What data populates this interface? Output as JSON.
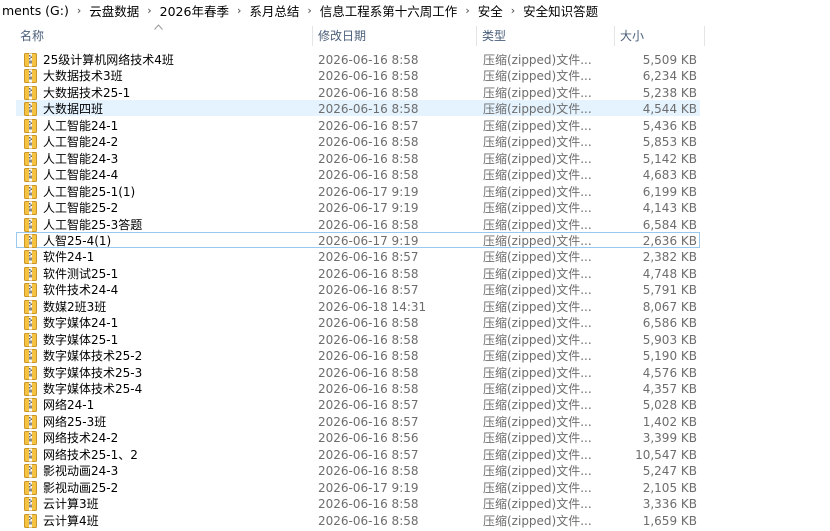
{
  "breadcrumb": [
    "ments (G:)",
    "云盘数据",
    "2026年春季",
    "系月总结",
    "信息工程系第十六周工作",
    "安全",
    "安全知识答题"
  ],
  "columns": {
    "name": "名称",
    "date": "修改日期",
    "type": "类型",
    "size": "大小"
  },
  "files": [
    {
      "name": "25级计算机网络技术4班",
      "date": "2026-06-16 8:58",
      "type": "压缩(zipped)文件...",
      "size": "5,509 KB"
    },
    {
      "name": "大数据技术3班",
      "date": "2026-06-16 8:58",
      "type": "压缩(zipped)文件...",
      "size": "6,234 KB"
    },
    {
      "name": "大数据技术25-1",
      "date": "2026-06-16 8:58",
      "type": "压缩(zipped)文件...",
      "size": "5,238 KB"
    },
    {
      "name": "大数据四班",
      "date": "2026-06-16 8:58",
      "type": "压缩(zipped)文件...",
      "size": "4,544 KB"
    },
    {
      "name": "人工智能24-1",
      "date": "2026-06-16 8:57",
      "type": "压缩(zipped)文件...",
      "size": "5,436 KB"
    },
    {
      "name": "人工智能24-2",
      "date": "2026-06-16 8:58",
      "type": "压缩(zipped)文件...",
      "size": "5,853 KB"
    },
    {
      "name": "人工智能24-3",
      "date": "2026-06-16 8:58",
      "type": "压缩(zipped)文件...",
      "size": "5,142 KB"
    },
    {
      "name": "人工智能24-4",
      "date": "2026-06-16 8:58",
      "type": "压缩(zipped)文件...",
      "size": "4,683 KB"
    },
    {
      "name": "人工智能25-1(1)",
      "date": "2026-06-17 9:19",
      "type": "压缩(zipped)文件...",
      "size": "6,199 KB"
    },
    {
      "name": "人工智能25-2",
      "date": "2026-06-17 9:19",
      "type": "压缩(zipped)文件...",
      "size": "4,143 KB"
    },
    {
      "name": "人工智能25-3答题",
      "date": "2026-06-16 8:58",
      "type": "压缩(zipped)文件...",
      "size": "6,584 KB"
    },
    {
      "name": "人智25-4(1)",
      "date": "2026-06-17 9:19",
      "type": "压缩(zipped)文件...",
      "size": "2,636 KB"
    },
    {
      "name": "软件24-1",
      "date": "2026-06-16 8:57",
      "type": "压缩(zipped)文件...",
      "size": "2,382 KB"
    },
    {
      "name": "软件测试25-1",
      "date": "2026-06-16 8:58",
      "type": "压缩(zipped)文件...",
      "size": "4,748 KB"
    },
    {
      "name": "软件技术24-4",
      "date": "2026-06-16 8:57",
      "type": "压缩(zipped)文件...",
      "size": "5,791 KB"
    },
    {
      "name": "数媒2班3班",
      "date": "2026-06-18 14:31",
      "type": "压缩(zipped)文件...",
      "size": "8,067 KB"
    },
    {
      "name": "数字媒体24-1",
      "date": "2026-06-16 8:58",
      "type": "压缩(zipped)文件...",
      "size": "6,586 KB"
    },
    {
      "name": "数字媒体25-1",
      "date": "2026-06-16 8:58",
      "type": "压缩(zipped)文件...",
      "size": "5,903 KB"
    },
    {
      "name": "数字媒体技术25-2",
      "date": "2026-06-16 8:58",
      "type": "压缩(zipped)文件...",
      "size": "5,190 KB"
    },
    {
      "name": "数字媒体技术25-3",
      "date": "2026-06-16 8:58",
      "type": "压缩(zipped)文件...",
      "size": "4,576 KB"
    },
    {
      "name": "数字媒体技术25-4",
      "date": "2026-06-16 8:58",
      "type": "压缩(zipped)文件...",
      "size": "4,357 KB"
    },
    {
      "name": "网络24-1",
      "date": "2026-06-16 8:57",
      "type": "压缩(zipped)文件...",
      "size": "5,028 KB"
    },
    {
      "name": "网络25-3班",
      "date": "2026-06-16 8:57",
      "type": "压缩(zipped)文件...",
      "size": "1,402 KB"
    },
    {
      "name": "网络技术24-2",
      "date": "2026-06-16 8:56",
      "type": "压缩(zipped)文件...",
      "size": "3,399 KB"
    },
    {
      "name": "网络技术25-1、2",
      "date": "2026-06-16 8:57",
      "type": "压缩(zipped)文件...",
      "size": "10,547 KB"
    },
    {
      "name": "影视动画24-3",
      "date": "2026-06-16 8:58",
      "type": "压缩(zipped)文件...",
      "size": "5,247 KB"
    },
    {
      "name": "影视动画25-2",
      "date": "2026-06-17 9:19",
      "type": "压缩(zipped)文件...",
      "size": "2,105 KB"
    },
    {
      "name": "云计算3班",
      "date": "2026-06-16 8:58",
      "type": "压缩(zipped)文件...",
      "size": "3,336 KB"
    },
    {
      "name": "云计算4班",
      "date": "2026-06-16 8:58",
      "type": "压缩(zipped)文件...",
      "size": "1,659 KB"
    }
  ],
  "selected_row": "大数据四班",
  "focused_row": "人智25-4(1)",
  "icons": {
    "file": "zip-folder-icon",
    "sort": "sort-ascending-icon",
    "separator": "chevron-right-icon"
  },
  "colors": {
    "selected_bg": "#e5f3ff",
    "focus_border": "#99c9ef",
    "header_text": "#4c607a",
    "zip_folder": "#f5c242"
  }
}
